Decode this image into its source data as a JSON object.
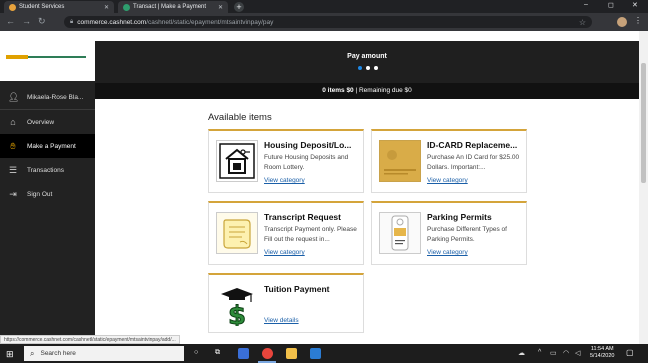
{
  "browser": {
    "tabs": [
      {
        "label": "Student Services",
        "color": "#e8a33d"
      },
      {
        "label": "Transact | Make a Payment",
        "color": "#2e9e6e"
      }
    ],
    "new_tab_symbol": "+",
    "window_controls": [
      "–",
      "◻",
      "✕"
    ],
    "url_host": "commerce.cashnet.com",
    "url_path": "/cashnetl/static/epayment/mtsaintvinpay/pay"
  },
  "sidebar": {
    "user_name": "Mikaela-Rose Bla...",
    "items": [
      {
        "label": "Overview",
        "icon": "home-icon"
      },
      {
        "label": "Make a Payment",
        "icon": "payment-icon"
      },
      {
        "label": "Transactions",
        "icon": "list-icon"
      },
      {
        "label": "Sign Out",
        "icon": "sign-out-icon"
      }
    ]
  },
  "header": {
    "pay_amount_label": "Pay amount",
    "summary_items": "0 items $0",
    "summary_separator": " | ",
    "summary_remaining": "Remaining due $0"
  },
  "main": {
    "available_title": "Available items",
    "cards": [
      {
        "title": "Housing Deposit/Lo...",
        "description": "Future Housing Deposits and Room Lottery.",
        "link": "View category",
        "icon": "house-key-icon"
      },
      {
        "title": "ID-CARD Replaceme...",
        "description": "Purchase An ID Card for $25.00 Dollars. Important:...",
        "link": "View category",
        "icon": "id-card-icon"
      },
      {
        "title": "Transcript Request",
        "description": "Transcript Payment only. Please Fill out the request in...",
        "link": "View category",
        "icon": "scroll-icon"
      },
      {
        "title": "Parking Permits",
        "description": "Purchase Different Types of Parking Permits.",
        "link": "View category",
        "icon": "parking-tag-icon"
      },
      {
        "title": "Tuition Payment",
        "description": "",
        "link": "View details",
        "icon": "dollar-cap-icon"
      }
    ]
  },
  "status_url": "https://commerce.cashnet.com/cashnetl/static/epayment/mtsaintvinpay/add/...",
  "taskbar": {
    "search_placeholder": "Search here",
    "time": "11:54 AM",
    "date": "5/14/2020"
  }
}
